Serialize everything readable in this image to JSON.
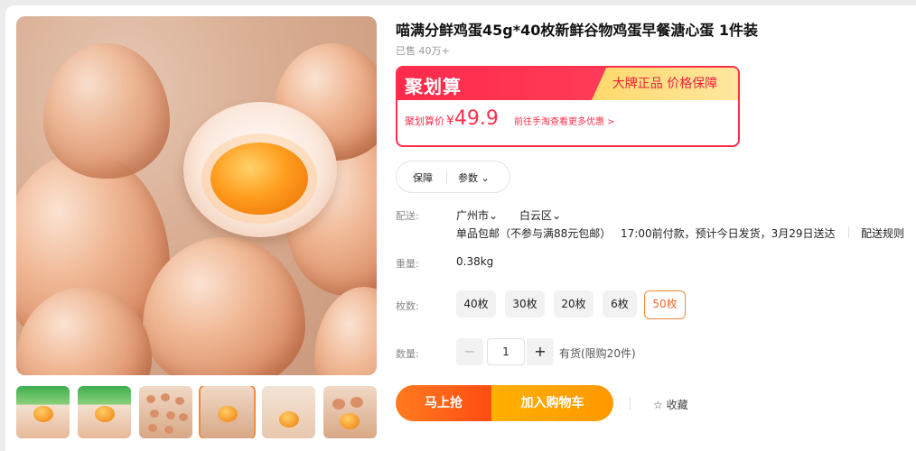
{
  "product": {
    "title": "喵满分鲜鸡蛋45g*40枚新鲜谷物鸡蛋早餐溏心蛋 1件装",
    "sold": "已售 40万+"
  },
  "promo": {
    "brand": "聚划算",
    "tag": "大牌正品 价格保障",
    "price_label": "聚划算价",
    "currency": "¥",
    "price": "49.9",
    "link": "前往手淘查看更多优惠 >"
  },
  "tabs": {
    "guarantee": "保障",
    "params": "参数 ⌄"
  },
  "delivery": {
    "label": "配送:",
    "city": "广州市⌄",
    "district": "白云区⌄",
    "shipping": "单品包邮（不参与满88元包邮）",
    "eta": "17:00前付款，预计今日发货，3月29日送达",
    "rules": "配送规则"
  },
  "weight": {
    "label": "重量:",
    "value": "0.38kg"
  },
  "count": {
    "label": "枚数:",
    "options": [
      "40枚",
      "30枚",
      "20枚",
      "6枚",
      "50枚"
    ],
    "selected": "50枚"
  },
  "quantity": {
    "label": "数量:",
    "minus": "−",
    "value": "1",
    "plus": "+",
    "stock": "有货(限购20件)"
  },
  "actions": {
    "buy": "马上抢",
    "cart": "加入购物车",
    "favorite": "☆ 收藏"
  },
  "colors": {
    "accent_red": "#ff2f4d",
    "accent_orange": "#ff7a1e",
    "cart_yellow": "#ffb000"
  }
}
